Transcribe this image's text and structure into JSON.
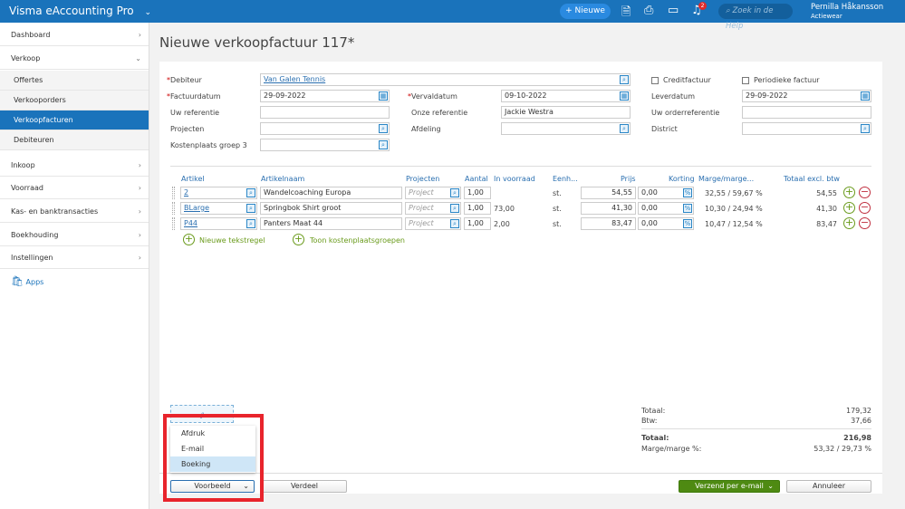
{
  "topbar": {
    "app_title": "Visma eAccounting Pro",
    "new_label": "Nieuwe",
    "help_placeholder": "Zoek in de Help",
    "notification_count": "2",
    "user_name": "Pernilla Håkansson",
    "company": "Actiewear"
  },
  "sidebar": {
    "items": [
      {
        "label": "Dashboard"
      },
      {
        "label": "Verkoop"
      },
      {
        "label": "Inkoop"
      },
      {
        "label": "Voorraad"
      },
      {
        "label": "Kas- en banktransacties"
      },
      {
        "label": "Boekhouding"
      },
      {
        "label": "Instellingen"
      },
      {
        "label": "Apps"
      }
    ],
    "subitems": [
      {
        "label": "Offertes"
      },
      {
        "label": "Verkooporders"
      },
      {
        "label": "Verkoopfacturen"
      },
      {
        "label": "Debiteuren"
      }
    ]
  },
  "page": {
    "title": "Nieuwe verkoopfactuur 117*"
  },
  "form": {
    "debiteur": {
      "label": "Debiteur",
      "value": "Van Galen Tennis"
    },
    "factuurdatum": {
      "label": "Factuurdatum",
      "value": "29-09-2022"
    },
    "uw_referentie": {
      "label": "Uw referentie",
      "value": ""
    },
    "projecten": {
      "label": "Projecten",
      "value": ""
    },
    "kostenplaats": {
      "label": "Kostenplaats groep 3",
      "value": ""
    },
    "vervaldatum": {
      "label": "Vervaldatum",
      "value": "09-10-2022"
    },
    "onze_referentie": {
      "label": "Onze referentie",
      "value": "Jackie Westra"
    },
    "afdeling": {
      "label": "Afdeling",
      "value": ""
    },
    "creditfactuur": {
      "label": "Creditfactuur",
      "checked": false
    },
    "periodieke": {
      "label": "Periodieke factuur",
      "checked": false
    },
    "leverdatum": {
      "label": "Leverdatum",
      "value": "29-09-2022"
    },
    "uw_orderreferentie": {
      "label": "Uw orderreferentie",
      "value": ""
    },
    "district": {
      "label": "District",
      "value": ""
    }
  },
  "table": {
    "headers": [
      "Artikel",
      "Artikelnaam",
      "Projecten",
      "Aantal",
      "In voorraad",
      "Eenh...",
      "Prijs",
      "Korting",
      "Marge/marge...",
      "Totaal excl. btw"
    ],
    "project_placeholder": "Project",
    "rows": [
      {
        "artikel": "2",
        "naam": "Wandelcoaching Europa",
        "aantal": "1,00",
        "voorraad": "",
        "eenheid": "st.",
        "prijs": "54,55",
        "korting": "0,00",
        "marge": "32,55 / 59,67 %",
        "totaal": "54,55"
      },
      {
        "artikel": "BLarge",
        "naam": "Springbok Shirt groot",
        "aantal": "1,00",
        "voorraad": "73,00",
        "eenheid": "st.",
        "prijs": "41,30",
        "korting": "0,00",
        "marge": "10,30 / 24,94 %",
        "totaal": "41,30"
      },
      {
        "artikel": "P44",
        "naam": "Panters Maat 44",
        "aantal": "1,00",
        "voorraad": "2,00",
        "eenheid": "st.",
        "prijs": "83,47",
        "korting": "0,00",
        "marge": "10,47 / 12,54 %",
        "totaal": "83,47"
      }
    ],
    "new_text_line": "Nieuwe tekstregel",
    "show_cost_groups": "Toon kostenplaatsgroepen"
  },
  "totals": {
    "totaal_label": "Totaal:",
    "totaal": "179,32",
    "btw_label": "Btw:",
    "btw": "37,66",
    "grand_label": "Totaal:",
    "grand": "216,98",
    "marge_label": "Marge/marge %:",
    "marge": "53,32 / 29,73 %"
  },
  "footer": {
    "preview": "Voorbeeld",
    "menu": [
      "Afdruk",
      "E-mail",
      "Boeking"
    ],
    "verdeel": "Verdeel",
    "send": "Verzend per e-mail",
    "cancel": "Annuleer"
  },
  "colors": {
    "brand": "#1a73bb",
    "send": "#4e8a12",
    "highlight": "#e8242c"
  }
}
